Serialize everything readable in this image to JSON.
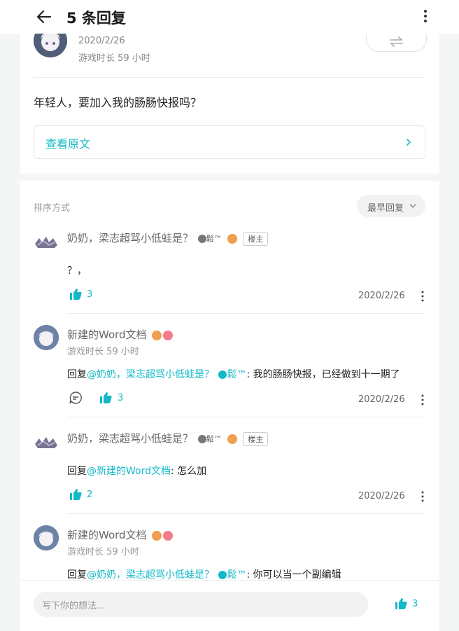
{
  "header": {
    "title": "5 条回复"
  },
  "post": {
    "date": "2020/2/26",
    "play_time": "游戏时长 59 小时",
    "text": "年轻人，要加入我的肠肠快报吗？",
    "view_original": "查看原文"
  },
  "replies_section": {
    "sort_label": "排序方式",
    "sort_value": "最早回复",
    "items": [
      {
        "author": "奶奶，梁志超骂小低蛙是？",
        "verified_name": "鬆™",
        "tag": "楼主",
        "text": "？，",
        "likes": "3",
        "date": "2020/2/26"
      },
      {
        "author": "新建的Word文档",
        "play_time": "游戏时长 59 小时",
        "text_prefix": "回复",
        "mention": "@奶奶，梁志超骂小低蛙是？",
        "mention_suffix": "鬆™",
        "text_body": ": 我的肠肠快报，已经做到十一期了",
        "likes": "3",
        "date": "2020/2/26"
      },
      {
        "author": "奶奶，梁志超骂小低蛙是？",
        "verified_name": "鬆™",
        "tag": "楼主",
        "text_prefix": "回复",
        "mention": "@新建的Word文档",
        "text_body": ": 怎么加",
        "likes": "2",
        "date": "2020/2/26"
      },
      {
        "author": "新建的Word文档",
        "play_time": "游戏时长 59 小时",
        "text_prefix": "回复",
        "mention": "@奶奶，梁志超骂小低蛙是？",
        "mention_suffix": "鬆™",
        "text_body": ": 你可以当一个副编辑"
      }
    ]
  },
  "bottom": {
    "placeholder": "写下你的想法...",
    "likes": "3"
  },
  "colors": {
    "accent": "#14b9c8",
    "badge_orange": "#ef9f4f",
    "badge_pink": "#f17c8a"
  }
}
